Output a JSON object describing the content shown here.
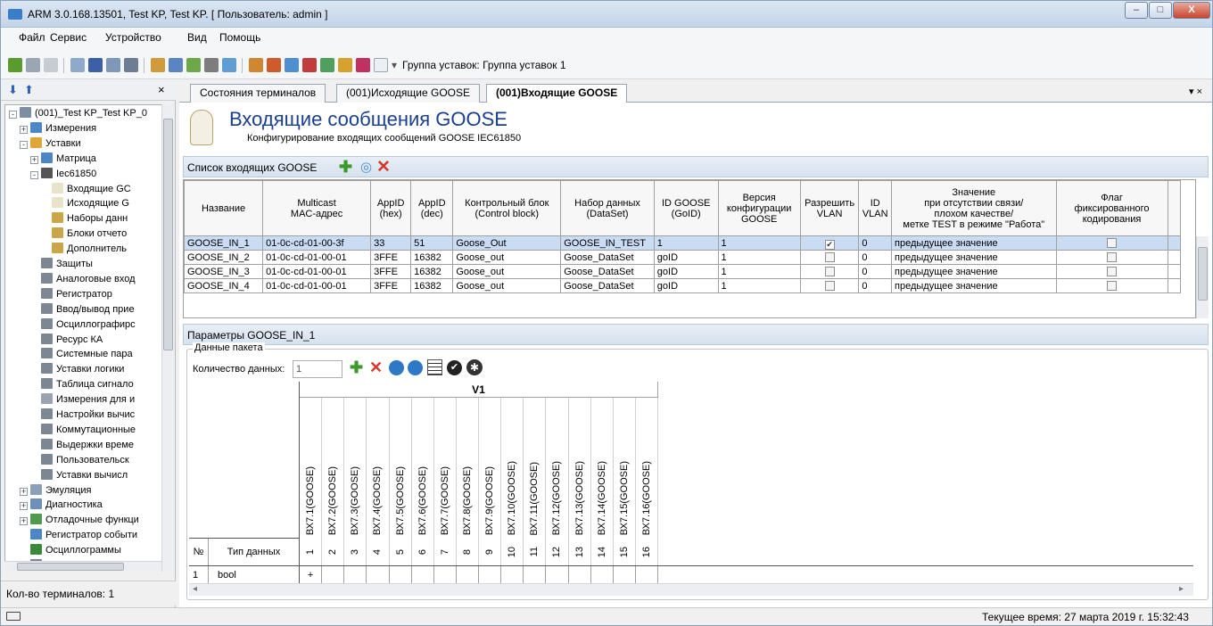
{
  "window": {
    "title": "ARM 3.0.168.13501, Test KP, Test KP. [ Пользователь: admin ]",
    "buttons": [
      "–",
      "□",
      "X"
    ]
  },
  "menu": [
    "Файл",
    "Сервис",
    "Устройство",
    "Вид",
    "Помощь"
  ],
  "toolbar": {
    "group_label": "Группа уставок: Группа уставок 1"
  },
  "tree": {
    "items": [
      {
        "label": "(001)_Test KP_Test KP_0",
        "level": 0,
        "icon": "device-icon",
        "expand": "-"
      },
      {
        "label": "Измерения",
        "level": 1,
        "icon": "measurements-icon",
        "expand": "+"
      },
      {
        "label": "Уставки",
        "level": 1,
        "icon": "folder-icon",
        "expand": "-"
      },
      {
        "label": "Матрица",
        "level": 2,
        "icon": "matrix-icon",
        "expand": "+"
      },
      {
        "label": "Iec61850",
        "level": 2,
        "icon": "iec-icon",
        "expand": "-"
      },
      {
        "label": "Входящие GC",
        "level": 3,
        "icon": "goose-icon",
        "expand": ""
      },
      {
        "label": "Исходящие G",
        "level": 3,
        "icon": "goose-icon",
        "expand": ""
      },
      {
        "label": "Наборы данн",
        "level": 3,
        "icon": "dataset-icon",
        "expand": ""
      },
      {
        "label": "Блоки отчето",
        "level": 3,
        "icon": "dataset-icon",
        "expand": ""
      },
      {
        "label": "Дополнитель",
        "level": 3,
        "icon": "dataset-icon",
        "expand": ""
      },
      {
        "label": "Защиты",
        "level": 2,
        "icon": "table-icon",
        "expand": ""
      },
      {
        "label": "Аналоговые вход",
        "level": 2,
        "icon": "table-icon",
        "expand": ""
      },
      {
        "label": "Регистратор",
        "level": 2,
        "icon": "table-icon",
        "expand": ""
      },
      {
        "label": "Ввод/вывод прие",
        "level": 2,
        "icon": "table-icon",
        "expand": ""
      },
      {
        "label": "Осциллографирс",
        "level": 2,
        "icon": "table-icon",
        "expand": ""
      },
      {
        "label": "Ресурс КА",
        "level": 2,
        "icon": "table-icon",
        "expand": ""
      },
      {
        "label": "Системные пара",
        "level": 2,
        "icon": "table-icon",
        "expand": ""
      },
      {
        "label": "Уставки логики",
        "level": 2,
        "icon": "table-icon",
        "expand": ""
      },
      {
        "label": "Таблица сигнало",
        "level": 2,
        "icon": "table-icon",
        "expand": ""
      },
      {
        "label": "Измерения для и",
        "level": 2,
        "icon": "pen-icon",
        "expand": ""
      },
      {
        "label": "Настройки вычис",
        "level": 2,
        "icon": "table-icon",
        "expand": ""
      },
      {
        "label": "Коммутационные",
        "level": 2,
        "icon": "table-icon",
        "expand": ""
      },
      {
        "label": "Выдержки време",
        "level": 2,
        "icon": "table-icon",
        "expand": ""
      },
      {
        "label": "Пользовательск",
        "level": 2,
        "icon": "table-icon",
        "expand": ""
      },
      {
        "label": "Уставки вычисл",
        "level": 2,
        "icon": "table-icon",
        "expand": ""
      },
      {
        "label": "Эмуляция",
        "level": 1,
        "icon": "emulation-icon",
        "expand": "+"
      },
      {
        "label": "Диагностика",
        "level": 1,
        "icon": "diagnostics-icon",
        "expand": "+"
      },
      {
        "label": "Отладочные функци",
        "level": 1,
        "icon": "debug-icon",
        "expand": "+"
      },
      {
        "label": "Регистратор событи",
        "level": 1,
        "icon": "events-icon",
        "expand": ""
      },
      {
        "label": "Осциллограммы",
        "level": 1,
        "icon": "oscillogram-icon",
        "expand": ""
      },
      {
        "label": "Регистратор поврежд",
        "level": 1,
        "icon": "table-icon",
        "expand": ""
      }
    ],
    "footer": "Кол-во терминалов: 1"
  },
  "tabs": [
    {
      "label": "Состояния терминалов",
      "active": false
    },
    {
      "label": "(001)Исходящие GOOSE",
      "active": false
    },
    {
      "label": "(001)Входящие GOOSE",
      "active": true
    }
  ],
  "header": {
    "title": "Входящие сообщения GOOSE",
    "subtitle": "Конфигурирование входящих сообщений GOOSE IEC61850"
  },
  "list": {
    "title": "Список входящих GOOSE",
    "columns": [
      "Название",
      "Multicast\nMAC-адрес",
      "AppID\n(hex)",
      "AppID\n(dec)",
      "Контрольный блок\n(Control block)",
      "Набор данных\n(DataSet)",
      "ID GOOSE\n(GoID)",
      "Версия\nконфигурации\nGOOSE",
      "Разрешить\nVLAN",
      "ID\nVLAN",
      "Значение\nпри отсутствии связи/\nплохом качестве/\nметке TEST в режиме \"Работа\"",
      "Флаг\nфиксированного\nкодирования"
    ],
    "rows": [
      {
        "name": "GOOSE_IN_1",
        "mac": "01-0c-cd-01-00-3f",
        "appid_hex": "33",
        "appid_dec": "51",
        "cb": "Goose_Out",
        "dataset": "GOOSE_IN_TEST",
        "goid": "1",
        "confver": "1",
        "vlan": true,
        "vlan_id": "0",
        "value": "предыдущее значение",
        "fixed": false,
        "selected": true
      },
      {
        "name": "GOOSE_IN_2",
        "mac": "01-0c-cd-01-00-01",
        "appid_hex": "3FFE",
        "appid_dec": "16382",
        "cb": "Goose_out",
        "dataset": "Goose_DataSet",
        "goid": "goID",
        "confver": "1",
        "vlan": false,
        "vlan_id": "0",
        "value": "предыдущее значение",
        "fixed": false,
        "selected": false
      },
      {
        "name": "GOOSE_IN_3",
        "mac": "01-0c-cd-01-00-01",
        "appid_hex": "3FFE",
        "appid_dec": "16382",
        "cb": "Goose_out",
        "dataset": "Goose_DataSet",
        "goid": "goID",
        "confver": "1",
        "vlan": false,
        "vlan_id": "0",
        "value": "предыдущее значение",
        "fixed": false,
        "selected": false
      },
      {
        "name": "GOOSE_IN_4",
        "mac": "01-0c-cd-01-00-01",
        "appid_hex": "3FFE",
        "appid_dec": "16382",
        "cb": "Goose_out",
        "dataset": "Goose_DataSet",
        "goid": "goID",
        "confver": "1",
        "vlan": false,
        "vlan_id": "0",
        "value": "предыдущее значение",
        "fixed": false,
        "selected": false
      }
    ]
  },
  "params": {
    "title": "Параметры  GOOSE_IN_1",
    "group_label": "Данные пакета",
    "count_label": "Количество данных:",
    "count_value": "1",
    "v_header": "V1",
    "bits": [
      "ВХ7.1(GOOSE)",
      "ВХ7.2(GOOSE)",
      "ВХ7.3(GOOSE)",
      "ВХ7.4(GOOSE)",
      "ВХ7.5(GOOSE)",
      "ВХ7.6(GOOSE)",
      "ВХ7.7(GOOSE)",
      "ВХ7.8(GOOSE)",
      "ВХ7.9(GOOSE)",
      "ВХ7.10(GOOSE)",
      "ВХ7.11(GOOSE)",
      "ВХ7.12(GOOSE)",
      "ВХ7.13(GOOSE)",
      "ВХ7.14(GOOSE)",
      "ВХ7.15(GOOSE)",
      "ВХ7.16(GOOSE)"
    ],
    "bit_numbers": [
      "1",
      "2",
      "3",
      "4",
      "5",
      "6",
      "7",
      "8",
      "9",
      "10",
      "11",
      "12",
      "13",
      "14",
      "15",
      "16"
    ],
    "num_header": "№",
    "type_header": "Тип данных",
    "data_rows": [
      {
        "num": "1",
        "type": "bool",
        "first_cell": "+"
      }
    ]
  },
  "status": {
    "time": "Текущее время: 27 марта 2019 г. 15:32:43"
  },
  "colors": {
    "selected_row": "#c9dcf3",
    "title_blue": "#1b3f8f",
    "section_header": "#dbe5f1"
  }
}
